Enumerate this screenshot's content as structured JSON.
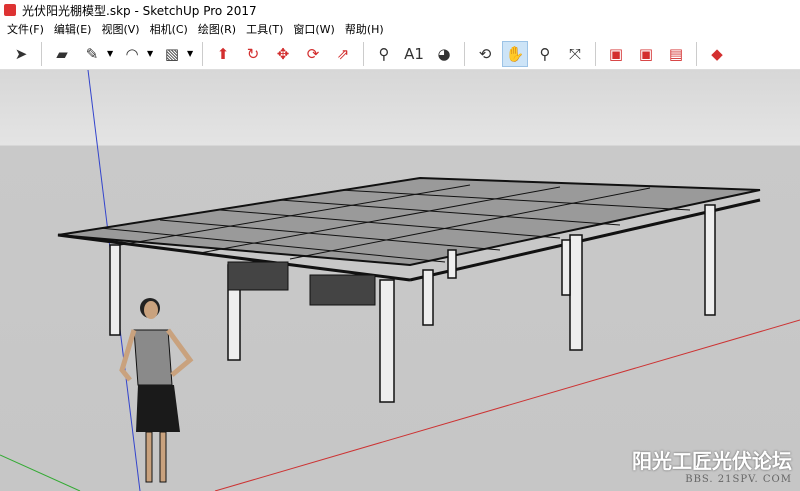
{
  "window": {
    "title": "光伏阳光棚模型.skp - SketchUp Pro 2017"
  },
  "menu": [
    "文件(F)",
    "编辑(E)",
    "视图(V)",
    "相机(C)",
    "绘图(R)",
    "工具(T)",
    "窗口(W)",
    "帮助(H)"
  ],
  "toolbar": [
    {
      "name": "select",
      "glyph": "➤"
    },
    {
      "name": "eraser",
      "glyph": "▰"
    },
    {
      "name": "pencil",
      "glyph": "✎",
      "dropdown": true
    },
    {
      "name": "arc",
      "glyph": "◠",
      "dropdown": true
    },
    {
      "name": "rectangle",
      "glyph": "▧",
      "dropdown": true
    },
    {
      "name": "push-pull",
      "glyph": "⬆"
    },
    {
      "name": "follow-me",
      "glyph": "↻"
    },
    {
      "name": "move",
      "glyph": "✥"
    },
    {
      "name": "rotate",
      "glyph": "⟳"
    },
    {
      "name": "scale",
      "glyph": "⇗"
    },
    {
      "name": "tape-measure",
      "glyph": "⚲"
    },
    {
      "name": "text",
      "glyph": "A1"
    },
    {
      "name": "paint-bucket",
      "glyph": "◕"
    },
    {
      "name": "orbit",
      "glyph": "⟲"
    },
    {
      "name": "pan",
      "glyph": "✋",
      "active": true
    },
    {
      "name": "zoom",
      "glyph": "⚲"
    },
    {
      "name": "zoom-extents",
      "glyph": "⤧"
    },
    {
      "name": "3d-warehouse",
      "glyph": "▣"
    },
    {
      "name": "extension-warehouse",
      "glyph": "▣"
    },
    {
      "name": "share-model",
      "glyph": "▤"
    },
    {
      "name": "extension-manager",
      "glyph": "◆"
    }
  ],
  "watermark": {
    "title": "阳光工匠光伏论坛",
    "url": "BBS. 21SPV. COM"
  },
  "colors": {
    "accent": "#d32f2f",
    "sky": "#d7d7d7",
    "ground": "#c6c6c6"
  }
}
